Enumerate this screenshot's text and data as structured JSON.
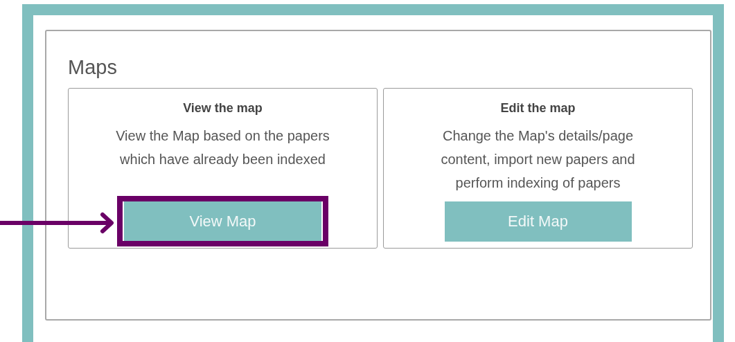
{
  "section": {
    "title": "Maps",
    "cards": [
      {
        "title": "View the map",
        "description": "View the Map based on the papers which have already been indexed",
        "button": "View Map",
        "highlighted": true
      },
      {
        "title": "Edit the map",
        "description": "Change the Map's details/page content, import new papers and perform indexing of papers",
        "button": "Edit Map",
        "highlighted": false
      }
    ]
  }
}
